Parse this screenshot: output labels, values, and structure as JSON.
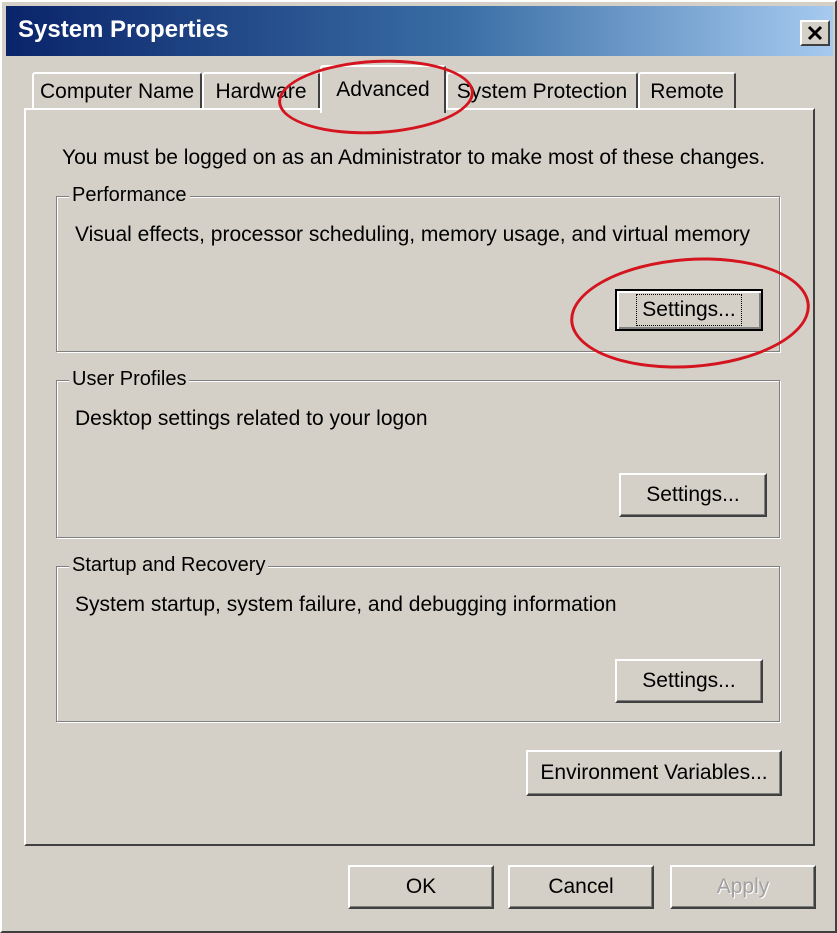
{
  "window": {
    "title": "System Properties",
    "close_glyph": "✕"
  },
  "tabs": [
    {
      "label": "Computer Name",
      "active": false
    },
    {
      "label": "Hardware",
      "active": false
    },
    {
      "label": "Advanced",
      "active": true
    },
    {
      "label": "System Protection",
      "active": false
    },
    {
      "label": "Remote",
      "active": false
    }
  ],
  "advanced": {
    "notice": "You must be logged on as an Administrator to make most of these changes.",
    "performance": {
      "title": "Performance",
      "description": "Visual effects, processor scheduling, memory usage, and virtual memory",
      "button_label": "Settings..."
    },
    "user_profiles": {
      "title": "User Profiles",
      "description": "Desktop settings related to your logon",
      "button_label": "Settings..."
    },
    "startup_recovery": {
      "title": "Startup and Recovery",
      "description": "System startup, system failure, and debugging information",
      "button_label": "Settings..."
    },
    "env_vars_label": "Environment Variables..."
  },
  "footer": {
    "ok_label": "OK",
    "cancel_label": "Cancel",
    "apply_label": "Apply"
  },
  "colors": {
    "dialog_bg": "#d4d0c8",
    "title_gradient_start": "#0a246a",
    "title_gradient_end": "#a6caf0",
    "annotation": "#d4141e"
  }
}
